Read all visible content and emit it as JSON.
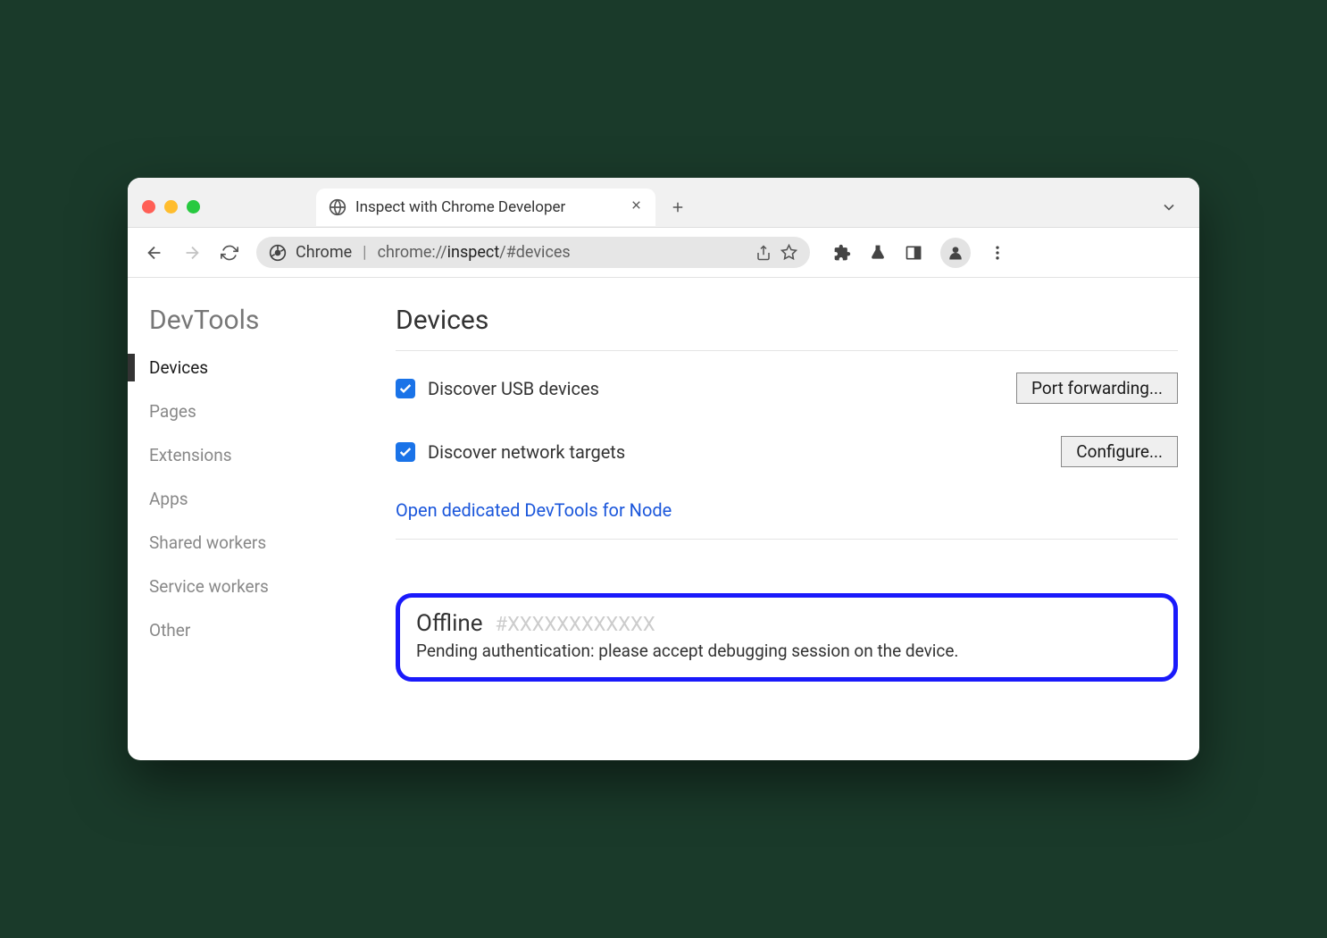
{
  "tab": {
    "title": "Inspect with Chrome Developer"
  },
  "omnibox": {
    "scheme_label": "Chrome",
    "url_prefix": "chrome://",
    "url_main": "inspect",
    "url_suffix": "/#devices"
  },
  "sidebar": {
    "title": "DevTools",
    "items": [
      {
        "label": "Devices",
        "active": true
      },
      {
        "label": "Pages",
        "active": false
      },
      {
        "label": "Extensions",
        "active": false
      },
      {
        "label": "Apps",
        "active": false
      },
      {
        "label": "Shared workers",
        "active": false
      },
      {
        "label": "Service workers",
        "active": false
      },
      {
        "label": "Other",
        "active": false
      }
    ]
  },
  "main": {
    "heading": "Devices",
    "discover_usb_label": "Discover USB devices",
    "discover_usb_checked": true,
    "port_forwarding_label": "Port forwarding...",
    "discover_network_label": "Discover network targets",
    "discover_network_checked": true,
    "configure_label": "Configure...",
    "node_link": "Open dedicated DevTools for Node",
    "device": {
      "status": "Offline",
      "id": "#XXXXXXXXXXXX",
      "message": "Pending authentication: please accept debugging session on the device."
    }
  }
}
